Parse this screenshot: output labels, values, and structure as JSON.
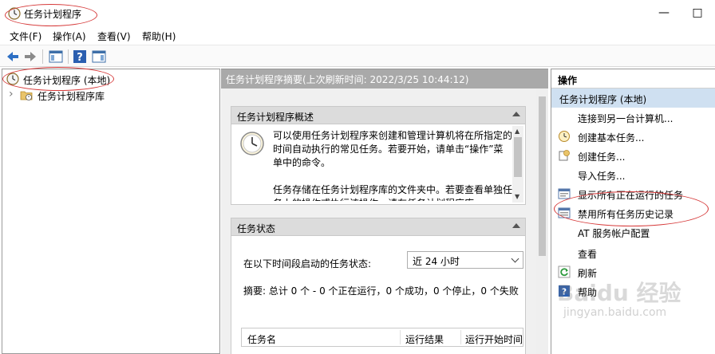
{
  "window": {
    "title": "任务计划程序",
    "minimize_glyph": "—",
    "maximize_glyph": "□"
  },
  "menu": [
    "文件(F)",
    "操作(A)",
    "查看(V)",
    "帮助(H)"
  ],
  "tree": {
    "root_label": "任务计划程序 (本地)",
    "child_label": "任务计划程序库",
    "expander": "›"
  },
  "center": {
    "header": "任务计划程序摘要(上次刷新时间: 2022/3/25 10:44:12)",
    "overview": {
      "title": "任务计划程序概述",
      "para1": "可以使用任务计划程序来创建和管理计算机将在所指定的时间自动执行的常见任务。若要开始，请单击“操作”菜单中的命令。",
      "para2": "任务存储在任务计划程序库的文件夹中。若要查看单独任务上的操作或执行该操作，请在任务计划程序库",
      "scroll_up": "▲",
      "scroll_down": "▼"
    },
    "status": {
      "title": "任务状态",
      "label": "在以下时间段启动的任务状态:",
      "range_value": "近 24 小时",
      "summary": "摘要: 总计 0 个 - 0 个正在运行，0 个成功，0 个停止，0 个失败",
      "columns": [
        "任务名",
        "运行结果",
        "运行开始时间"
      ]
    }
  },
  "actions": {
    "header": "操作",
    "section": "任务计划程序 (本地)",
    "items": [
      {
        "label": "连接到另一台计算机...",
        "icon": "none"
      },
      {
        "label": "创建基本任务...",
        "icon": "basic-task-icon"
      },
      {
        "label": "创建任务...",
        "icon": "task-icon"
      },
      {
        "label": "导入任务...",
        "icon": "none"
      },
      {
        "label": "显示所有正在运行的任务",
        "icon": "running-tasks-icon"
      },
      {
        "label": "禁用所有任务历史记录",
        "icon": "disable-history-icon"
      },
      {
        "label": "AT 服务帐户配置",
        "icon": "none"
      },
      {
        "label": "查看",
        "icon": "none"
      },
      {
        "label": "刷新",
        "icon": "refresh-icon"
      },
      {
        "label": "帮助",
        "icon": "help-icon"
      }
    ]
  },
  "watermark": {
    "brand": "Baidu 经验",
    "url": "jingyan.baidu.com"
  },
  "colors": {
    "annotation_red": "#d63a3a",
    "selected_blue": "#cfe0f1",
    "header_gray": "#a9a9a9"
  }
}
